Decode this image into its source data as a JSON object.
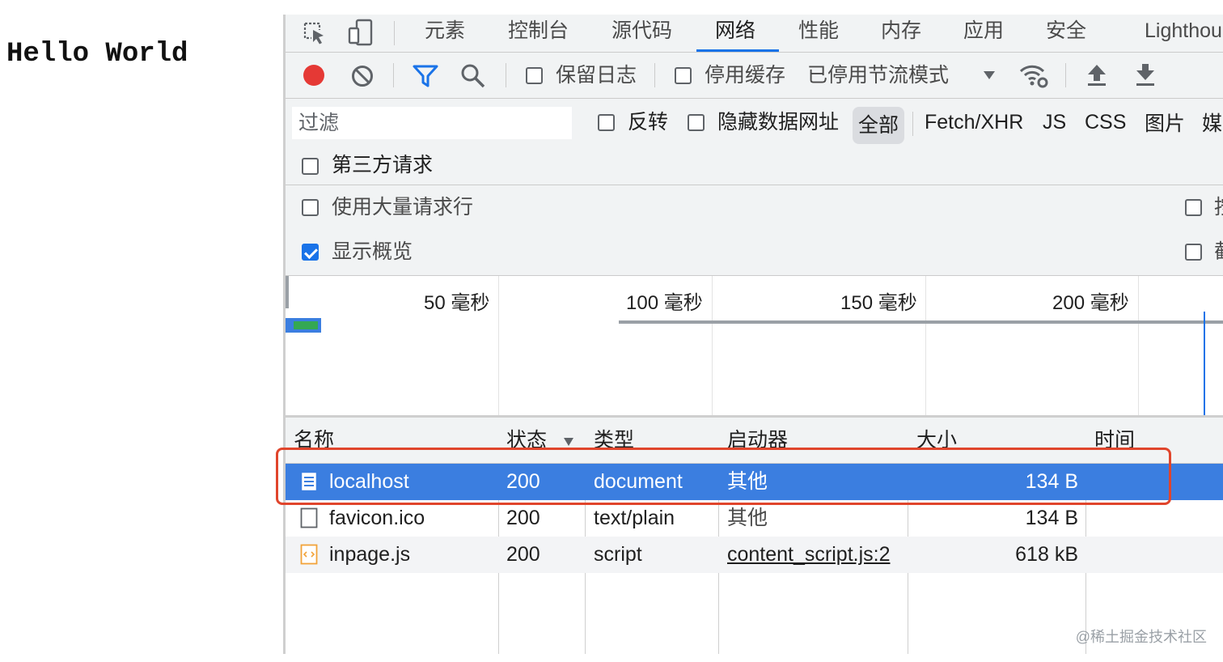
{
  "page": {
    "hello_text": "Hello World"
  },
  "tabs": [
    {
      "label": "元素"
    },
    {
      "label": "控制台"
    },
    {
      "label": "源代码"
    },
    {
      "label": "网络"
    },
    {
      "label": "性能"
    },
    {
      "label": "内存"
    },
    {
      "label": "应用"
    },
    {
      "label": "安全"
    },
    {
      "label": "Lighthou"
    }
  ],
  "toolbar": {
    "preserve_log_label": "保留日志",
    "disable_cache_label": "停用缓存",
    "throttle_label": "已停用节流模式"
  },
  "filter": {
    "placeholder": "过滤",
    "invert_label": "反转",
    "hide_data_urls_label": "隐藏数据网址",
    "types": [
      "全部",
      "Fetch/XHR",
      "JS",
      "CSS",
      "图片",
      "媒"
    ],
    "third_party_label": "第三方请求"
  },
  "settings": {
    "big_request_rows_label": "使用大量请求行",
    "show_overview_label": "显示概览",
    "right_partial_1": "按",
    "right_partial_2": "截"
  },
  "overview": {
    "ticks": [
      "50 毫秒",
      "100 毫秒",
      "150 毫秒",
      "200 毫秒"
    ]
  },
  "table": {
    "headers": {
      "name": "名称",
      "status": "状态",
      "type": "类型",
      "initiator": "启动器",
      "size": "大小",
      "time": "时间"
    },
    "rows": [
      {
        "name": "localhost",
        "status": "200",
        "type": "document",
        "initiator": "其他",
        "size": "134 B",
        "icon": "document-icon"
      },
      {
        "name": "favicon.ico",
        "status": "200",
        "type": "text/plain",
        "initiator": "其他",
        "size": "134 B",
        "icon": "blank-file-icon"
      },
      {
        "name": "inpage.js",
        "status": "200",
        "type": "script",
        "initiator": "content_script.js:2",
        "size": "618 kB",
        "icon": "script-file-icon"
      }
    ]
  },
  "watermark": "@稀土掘金技术社区",
  "colors": {
    "accent": "#1a73e8",
    "record": "#e53935",
    "highlight_box": "#e0452c",
    "selected_row": "#3b7ee0"
  }
}
